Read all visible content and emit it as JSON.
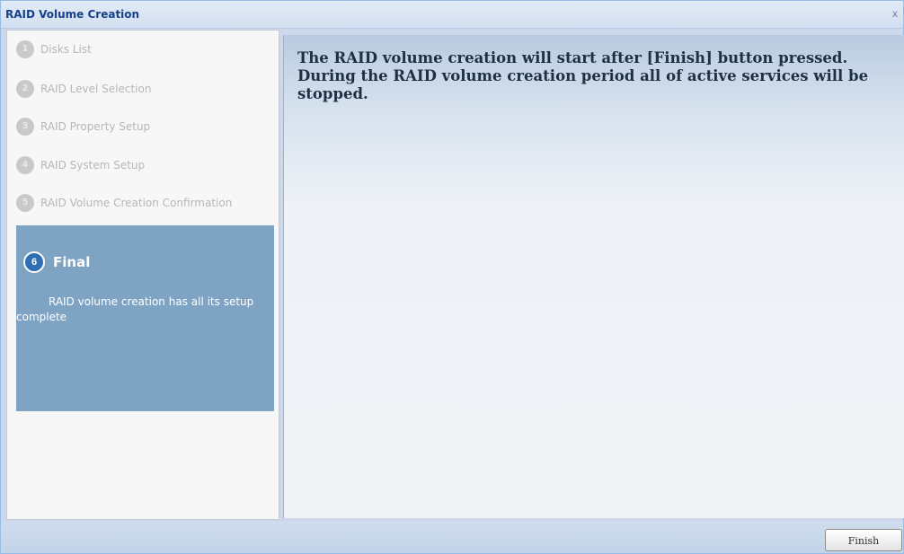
{
  "window": {
    "title": "RAID Volume Creation",
    "close_glyph": "x"
  },
  "steps": [
    {
      "number": "1",
      "label": "Disks List"
    },
    {
      "number": "2",
      "label": "RAID Level Selection"
    },
    {
      "number": "3",
      "label": "RAID Property Setup"
    },
    {
      "number": "4",
      "label": "RAID System Setup"
    },
    {
      "number": "5",
      "label": "RAID Volume Creation Confirmation"
    }
  ],
  "active_step": {
    "number": "6",
    "title": "Final",
    "description": "RAID volume creation has all its setup complete"
  },
  "main": {
    "message": "The RAID volume creation will start after [Finish] button pressed. During the RAID volume creation period all of active services will be stopped."
  },
  "footer": {
    "finish_label": "Finish"
  },
  "colors": {
    "active_step_bg": "#7ea3c3",
    "title_color": "#15428b"
  }
}
